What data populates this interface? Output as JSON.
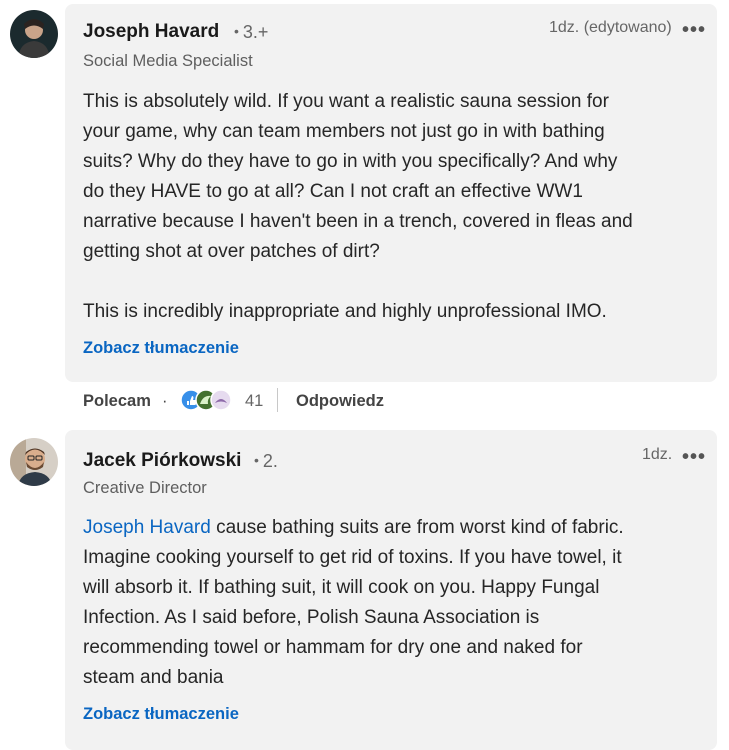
{
  "comments": [
    {
      "author": "Joseph Havard",
      "degree": "3.+",
      "headline": "Social Media Specialist",
      "meta": "1dz. (edytowano)",
      "body_line1": "This is absolutely wild. If you want a realistic sauna session for",
      "body_line2": "your game, why can team members not just go in with bathing",
      "body_line3": "suits? Why do they have to go in with you specifically? And why",
      "body_line4": "do they HAVE to go at all? Can I not craft an effective WW1",
      "body_line5": "narrative because I haven't been in a trench, covered in fleas and",
      "body_line6": "getting shot at over patches of dirt?",
      "body_line7": "This is incredibly inappropriate and highly unprofessional IMO.",
      "translate": "Zobacz tłumaczenie",
      "like_label": "Polecam",
      "reaction_count": "41",
      "reply_label": "Odpowiedz"
    },
    {
      "author": "Jacek Piórkowski",
      "degree": "2.",
      "headline": "Creative Director",
      "meta": "1dz.",
      "mention": "Joseph Havard",
      "body_line1_rest": " cause bathing suits are from worst kind of fabric.",
      "body_line2": "Imagine cooking yourself to get rid of toxins. If you have towel, it",
      "body_line3": "will absorb it. If bathing suit, it will cook on you. Happy Fungal",
      "body_line4": "Infection. As I said before, Polish Sauna Association is",
      "body_line5": "recommending towel or hammam for dry one and naked for",
      "body_line6": "steam and bania",
      "translate": "Zobacz tłumaczenie"
    }
  ],
  "separator_dot": "·",
  "degree_dot": "•",
  "more_icon": "•••",
  "colors": {
    "link": "#0a66c2",
    "bubble": "#f2f2f2"
  }
}
